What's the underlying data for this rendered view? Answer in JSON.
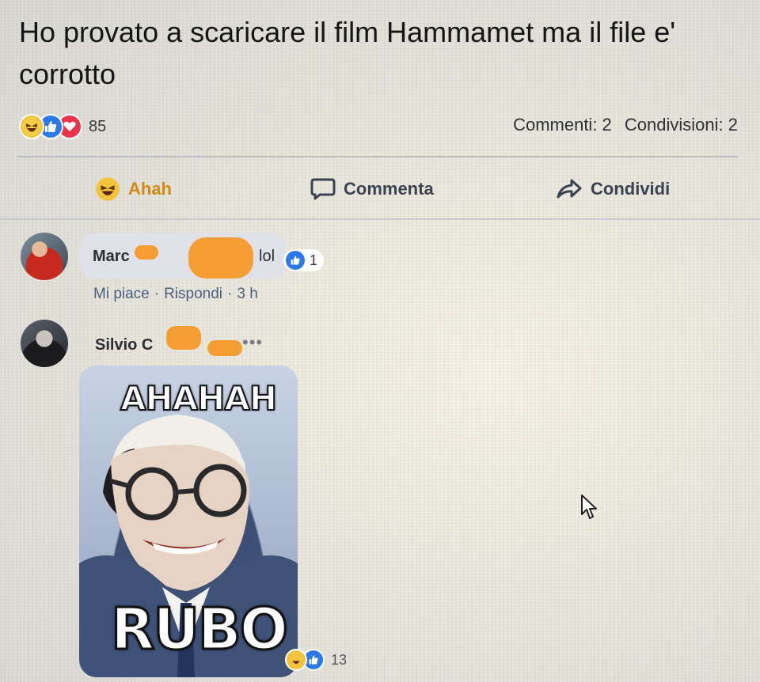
{
  "post": {
    "text": "Ho provato a scaricare il film Hammamet ma il file e' corrotto",
    "reaction_count": "85",
    "comments_stat": "Commenti: 2",
    "shares_stat": "Condivisioni: 2"
  },
  "actions": {
    "react_label": "Ahah",
    "comment_label": "Commenta",
    "share_label": "Condividi"
  },
  "comments": [
    {
      "author": "Marc",
      "text": "lol",
      "like_count": "1",
      "like_label": "Mi piace",
      "reply_label": "Rispondi",
      "time": "3 h"
    },
    {
      "author": "Silvio C",
      "ellipsis": "•••",
      "meme_top_text": "AHAHAH",
      "meme_bottom_text": "RUBO",
      "reaction_count": "13"
    }
  ],
  "colors": {
    "haha": "#f4c33d",
    "like": "#2c78e8",
    "love": "#e8344b",
    "redaction": "#f59a2a",
    "link_meta": "#4c5f7f"
  },
  "icons": [
    "haha-reaction-icon",
    "like-reaction-icon",
    "love-reaction-icon",
    "comment-icon",
    "share-icon",
    "mouse-cursor-icon"
  ]
}
